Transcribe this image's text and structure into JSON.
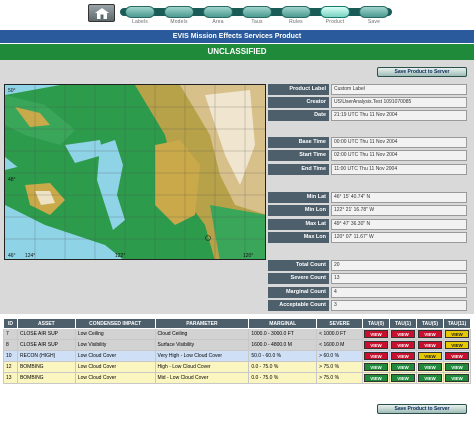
{
  "nav": {
    "items": [
      {
        "label": "Labels",
        "active": false
      },
      {
        "label": "Models",
        "active": false
      },
      {
        "label": "Area",
        "active": false
      },
      {
        "label": "Taus",
        "active": false
      },
      {
        "label": "Rules",
        "active": false
      },
      {
        "label": "Product",
        "active": true
      },
      {
        "label": "Save",
        "active": false
      }
    ]
  },
  "header": {
    "title": "EVIS Mission Effects Services Product",
    "classification": "UNCLASSIFIED"
  },
  "save_button_label": "Save Product to Server",
  "info": {
    "product_label": {
      "label": "Product Label",
      "value": "Custom Label"
    },
    "creator": {
      "label": "Creator",
      "value": "US\\UserAnalysis.Test 1091070085"
    },
    "date": {
      "label": "Date",
      "value": "21:19 UTC Thu 11 Nov 2004"
    },
    "base_time": {
      "label": "Base Time",
      "value": "00:00 UTC Thu 11 Nov 2004"
    },
    "start_time": {
      "label": "Start Time",
      "value": "02:00 UTC Thu 11 Nov 2004"
    },
    "end_time": {
      "label": "End Time",
      "value": "11:00 UTC Thu 11 Nov 2004"
    },
    "min_lat": {
      "label": "Min Lat",
      "value": "46° 15' 40.74\" N"
    },
    "min_lon": {
      "label": "Min Lon",
      "value": "122° 21' 16.78\" W"
    },
    "max_lat": {
      "label": "Max Lat",
      "value": "49° 47' 36.30\" N"
    },
    "max_lon": {
      "label": "Max Lon",
      "value": "120° 07' 11.67\" W"
    },
    "total_count": {
      "label": "Total Count",
      "value": "20"
    },
    "severe_count": {
      "label": "Severe Count",
      "value": "13"
    },
    "marginal_count": {
      "label": "Marginal Count",
      "value": "4"
    },
    "acceptable_count": {
      "label": "Acceptable Count",
      "value": "3"
    }
  },
  "map": {
    "lat_labels": [
      "50°",
      "48°",
      "46°"
    ],
    "lon_labels": [
      "124°",
      "122°",
      "120°"
    ]
  },
  "table": {
    "columns": [
      "ID",
      "ASSET",
      "CONDENSED IMPACT",
      "PARAMETER",
      "MARGINAL",
      "SEVERE",
      "TAU(0)",
      "TAU(1)",
      "TAU(5)",
      "TAU(11)"
    ],
    "rows": [
      {
        "id": "7",
        "asset": "CLOSE AIR SUP",
        "impact": "Low Ceiling",
        "parameter": "Cloud Ceiling",
        "marginal": "1000.0 - 3000.0 FT",
        "severe": "< 1000.0 FT",
        "style": "gray",
        "taus": [
          "red",
          "red",
          "red",
          "yellow"
        ]
      },
      {
        "id": "8",
        "asset": "CLOSE AIR SUP",
        "impact": "Low Visibility",
        "parameter": "Surface Visibility",
        "marginal": "1600.0 - 4800.0 M",
        "severe": "< 1600.0 M",
        "style": "gray",
        "taus": [
          "red",
          "red",
          "red",
          "yellow"
        ]
      },
      {
        "id": "10",
        "asset": "RECON (HIGH)",
        "impact": "Low Cloud Cover",
        "parameter": "Very High - Low Cloud Cover",
        "marginal": "50.0 - 60.0 %",
        "severe": "> 60.0 %",
        "style": "blue",
        "taus": [
          "red",
          "red",
          "yellow",
          "red"
        ]
      },
      {
        "id": "12",
        "asset": "BOMBING",
        "impact": "Low Cloud Cover",
        "parameter": "High - Low Cloud Cover",
        "marginal": "0.0 - 75.0 %",
        "severe": "> 75.0 %",
        "style": "yellow",
        "taus": [
          "green",
          "green",
          "green",
          "green"
        ]
      },
      {
        "id": "13",
        "asset": "BOMBING",
        "impact": "Low Cloud Cover",
        "parameter": "Mid - Low Cloud Cover",
        "marginal": "0.0 - 75.0 %",
        "severe": "> 75.0 %",
        "style": "yellow",
        "taus": [
          "green",
          "green",
          "green",
          "green"
        ]
      }
    ],
    "tau_button_label": "VIEW"
  },
  "colors": {
    "title_bar": "#2a5a9b",
    "classification_bar": "#1e8a3a",
    "label_bg": "#4e5f6c",
    "tau_red": "#c8102e",
    "tau_yellow": "#e6c800",
    "tau_green": "#1e8a3a"
  }
}
